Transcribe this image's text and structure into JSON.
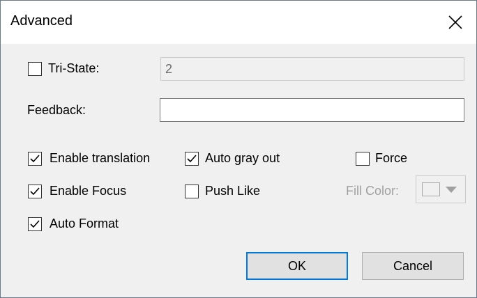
{
  "window": {
    "title": "Advanced"
  },
  "icons": {
    "close": "close-icon",
    "check": "check-icon",
    "dropdown": "chevron-down-icon"
  },
  "tri_state": {
    "label": "Tri-State:",
    "checked": false,
    "value": "2",
    "enabled": false
  },
  "feedback": {
    "label": "Feedback:",
    "value": ""
  },
  "options": {
    "enable_translation": {
      "label": "Enable translation",
      "checked": true
    },
    "auto_gray_out": {
      "label": "Auto gray out",
      "checked": true
    },
    "force": {
      "label": "Force",
      "checked": false
    },
    "enable_focus": {
      "label": "Enable Focus",
      "checked": true
    },
    "push_like": {
      "label": "Push Like",
      "checked": false
    },
    "auto_format": {
      "label": "Auto Format",
      "checked": true
    }
  },
  "fill_color": {
    "label": "Fill Color:",
    "enabled": false
  },
  "buttons": {
    "ok": "OK",
    "cancel": "Cancel"
  },
  "colors": {
    "default_button_border": "#0078d7",
    "disabled_text": "#a0a0a0",
    "dialog_background": "#f0f0f0"
  }
}
